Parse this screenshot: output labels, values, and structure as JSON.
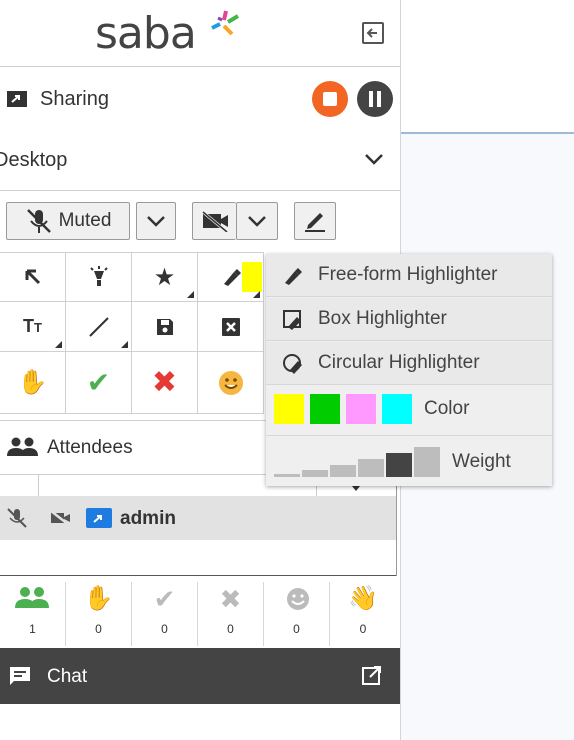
{
  "logo": {
    "text": "saba"
  },
  "sharing": {
    "label": "Sharing"
  },
  "source_select": {
    "value": "Desktop"
  },
  "audio": {
    "mic_label": "Muted"
  },
  "highlighter_menu": {
    "items": [
      {
        "label": "Free-form Highlighter"
      },
      {
        "label": "Box Highlighter"
      },
      {
        "label": "Circular Highlighter"
      }
    ],
    "color_label": "Color",
    "colors": [
      "#ffff00",
      "#00cc00",
      "#ff99ff",
      "#00ffff"
    ],
    "weight_label": "Weight",
    "weight_selected": 5
  },
  "attendees": {
    "label": "Attendees",
    "user": {
      "name": "admin"
    },
    "counts": [
      "1",
      "0",
      "0",
      "0",
      "0",
      "0"
    ]
  },
  "chat": {
    "label": "Chat"
  },
  "colors": {
    "stop": "#f26522",
    "pause": "#444444",
    "chat_bar": "#444444",
    "share_blue": "#1e7be0"
  }
}
